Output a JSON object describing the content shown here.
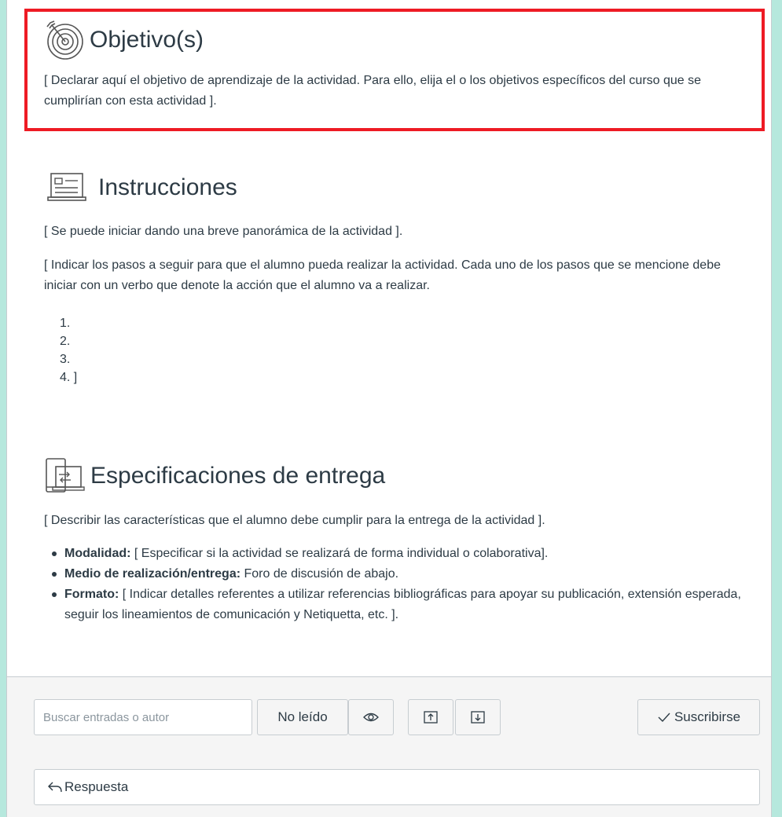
{
  "objective": {
    "icon": "target-icon",
    "title": "Objetivo(s)",
    "text": "[ Declarar aquí el objetivo de aprendizaje de la actividad. Para ello, elija el o los objetivos específicos del curso que se cumplirían con esta actividad ]."
  },
  "instructions": {
    "icon": "presentation-screen-icon",
    "title": "Instrucciones",
    "intro": "[ Se puede iniciar dando una breve panorámica de la actividad ].",
    "steps_text": "[ Indicar los pasos a seguir para que el alumno pueda realizar la actividad. Cada uno de los pasos que se mencione debe iniciar con un verbo que denote la acción que el alumno va a realizar.",
    "steps": [
      "1.",
      "2.",
      "3.",
      "4. ]"
    ]
  },
  "delivery": {
    "icon": "device-transfer-icon",
    "title": "Especificaciones de entrega",
    "intro": "[ Describir las características que el alumno debe cumplir para la entrega de la actividad ].",
    "items": [
      {
        "label": "Modalidad:",
        "text": " [ Especificar si la actividad se realizará de forma individual  o colaborativa]."
      },
      {
        "label": "Medio de realización/entrega:",
        "text": " Foro de discusión de abajo."
      },
      {
        "label": "Formato:",
        "text": " [ Indicar detalles referentes a utilizar referencias bibliográficas para apoyar su publicación, extensión esperada, seguir los lineamientos de comunicación y Netiquetta, etc. ]."
      }
    ]
  },
  "toolbar": {
    "search_placeholder": "Buscar entradas o autor",
    "unread_label": "No leído",
    "subscribe_label": "Suscribirse"
  },
  "reply": {
    "label": "Respuesta"
  },
  "colors": {
    "highlight": "#ee1b24",
    "background": "#b6e8dd",
    "text": "#2d3b45"
  }
}
